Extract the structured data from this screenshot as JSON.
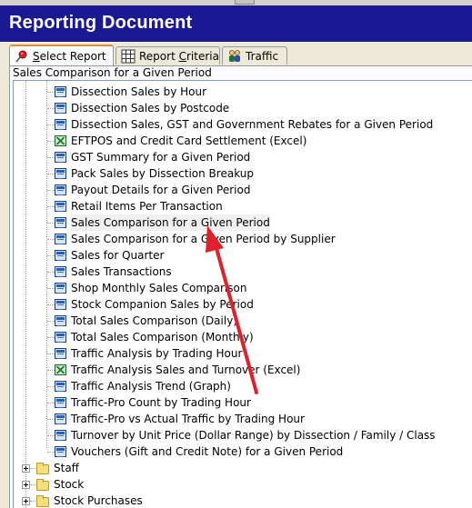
{
  "window": {
    "title": "Reporting Document"
  },
  "tabs": [
    {
      "label_prefix": "",
      "label_underline": "S",
      "label_rest": "elect Report",
      "icon": "pin-icon",
      "active": true
    },
    {
      "label_prefix": "Report ",
      "label_underline": "C",
      "label_rest": "riteria",
      "icon": "grid-icon",
      "active": false
    },
    {
      "label_prefix": "",
      "label_underline": "",
      "label_rest": "Traffic",
      "icon": "people-icon",
      "active": false
    }
  ],
  "breadcrumb": "Sales Comparison for a Given Period",
  "reports": [
    {
      "label": "Dissection Sales by Hour",
      "icon": "report-icon"
    },
    {
      "label": "Dissection Sales by Postcode",
      "icon": "report-icon"
    },
    {
      "label": "Dissection Sales, GST and Government Rebates for a Given Period",
      "icon": "report-icon"
    },
    {
      "label": "EFTPOS and Credit Card Settlement (Excel)",
      "icon": "excel-icon"
    },
    {
      "label": "GST Summary for a Given Period",
      "icon": "report-icon"
    },
    {
      "label": "Pack Sales by Dissection Breakup",
      "icon": "report-icon"
    },
    {
      "label": "Payout Details for a Given Period",
      "icon": "report-icon"
    },
    {
      "label": "Retail Items Per Transaction",
      "icon": "report-icon"
    },
    {
      "label": "Sales Comparison for a Given Period",
      "icon": "report-icon",
      "highlight": true
    },
    {
      "label": "Sales Comparison for a Given Period by Supplier",
      "icon": "report-icon"
    },
    {
      "label": "Sales for Quarter",
      "icon": "report-icon"
    },
    {
      "label": "Sales Transactions",
      "icon": "report-icon"
    },
    {
      "label": "Shop Monthly Sales Comparison",
      "icon": "report-icon"
    },
    {
      "label": "Stock Companion Sales by Period",
      "icon": "report-icon"
    },
    {
      "label": "Total Sales Comparison (Daily)",
      "icon": "report-icon"
    },
    {
      "label": "Total Sales Comparison (Monthly)",
      "icon": "report-icon"
    },
    {
      "label": "Traffic Analysis by Trading Hour",
      "icon": "report-icon"
    },
    {
      "label": "Traffic Analysis Sales and Turnover (Excel)",
      "icon": "excel-icon"
    },
    {
      "label": "Traffic Analysis Trend (Graph)",
      "icon": "report-icon"
    },
    {
      "label": "Traffic-Pro Count by Trading Hour",
      "icon": "report-icon"
    },
    {
      "label": "Traffic-Pro vs Actual Traffic by Trading Hour",
      "icon": "report-icon"
    },
    {
      "label": "Turnover by Unit Price (Dollar Range) by Dissection  / Family / Class",
      "icon": "report-icon"
    },
    {
      "label": "Vouchers (Gift and Credit Note) for a Given Period",
      "icon": "report-icon"
    }
  ],
  "folders": [
    {
      "label": "Staff",
      "icon": "folder-icon"
    },
    {
      "label": "Stock",
      "icon": "folder-icon"
    },
    {
      "label": "Stock Purchases",
      "icon": "folder-icon"
    }
  ],
  "colors": {
    "title_bar": "#1b1893",
    "annotation_arrow": "#e0202a"
  }
}
